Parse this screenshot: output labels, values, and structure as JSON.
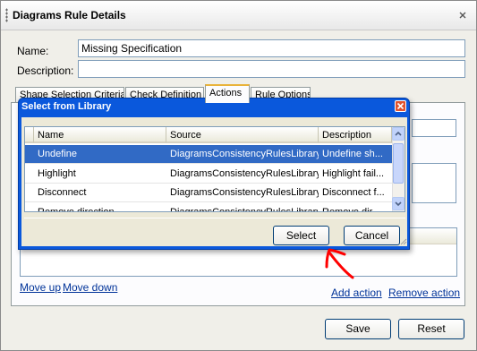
{
  "panel": {
    "title": "Diagrams Rule Details",
    "name_label": "Name:",
    "name_value": "Missing Specification",
    "description_label": "Description:",
    "description_value": ""
  },
  "tabs": [
    {
      "label": "Shape Selection Criteria",
      "active": false
    },
    {
      "label": "Check Definition",
      "active": false
    },
    {
      "label": "Actions",
      "active": true
    },
    {
      "label": "Rule Options",
      "active": false
    }
  ],
  "actions": {
    "move_up": "Move up",
    "move_down": "Move down",
    "add_action": "Add action",
    "remove_action": "Remove action"
  },
  "footer": {
    "save": "Save",
    "reset": "Reset"
  },
  "modal": {
    "title": "Select from Library",
    "columns": [
      "Name",
      "Source",
      "Description"
    ],
    "rows": [
      {
        "name": "Undefine",
        "source": "DiagramsConsistencyRulesLibrary",
        "description": "Undefine sh...",
        "selected": true
      },
      {
        "name": "Highlight",
        "source": "DiagramsConsistencyRulesLibrary",
        "description": "Highlight fail...",
        "selected": false
      },
      {
        "name": "Disconnect",
        "source": "DiagramsConsistencyRulesLibrary",
        "description": "Disconnect f...",
        "selected": false
      },
      {
        "name": "Remove direction",
        "source": "DiagramsConsistencyRulesLibrary",
        "description": "Remove dir...",
        "selected": false
      }
    ],
    "select": "Select",
    "cancel": "Cancel"
  },
  "colors": {
    "titlebar": "#0a58dc",
    "selection": "#316ac5",
    "link": "#003399",
    "annotation_arrow": "#ff0000"
  },
  "icons": [
    "close-icon",
    "modal-close-icon",
    "scroll-up-icon",
    "scroll-down-icon",
    "resize-grip-icon",
    "annotation-arrow"
  ]
}
